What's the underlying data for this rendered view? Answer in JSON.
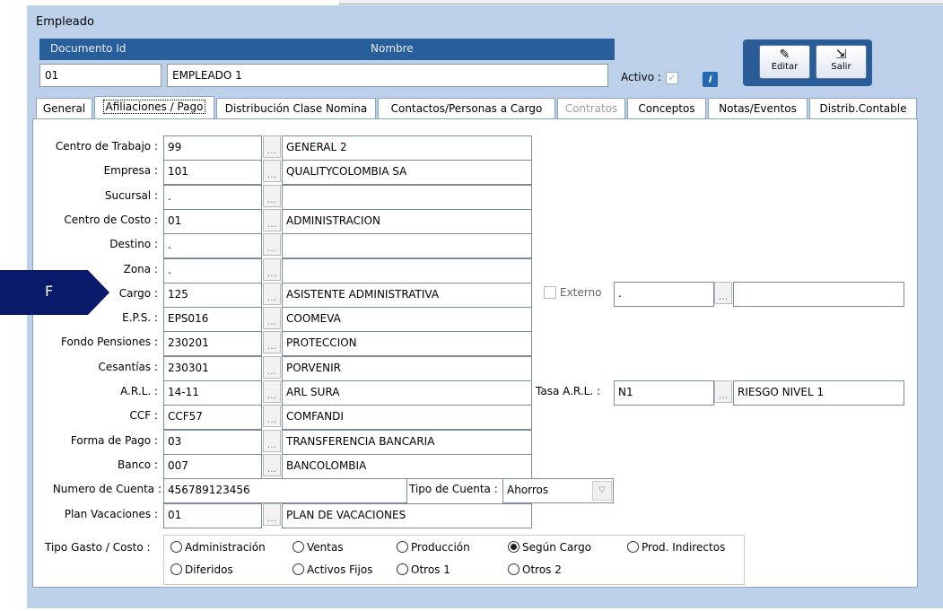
{
  "window": {
    "title": "Empleado"
  },
  "header": {
    "documento_label": "Documento Id",
    "nombre_label": "Nombre",
    "documento_value": "01",
    "nombre_value": "EMPLEADO 1",
    "activo_label": "Activo :",
    "activo_checked": true
  },
  "toolbar": {
    "editar_label": "Editar",
    "salir_label": "Salir"
  },
  "tabs": [
    {
      "label": "General"
    },
    {
      "label": "Afiliaciones / Pago",
      "active": true
    },
    {
      "label": "Distribución Clase Nomina"
    },
    {
      "label": "Contactos/Personas a Cargo"
    },
    {
      "label": "Contratos",
      "disabled": true
    },
    {
      "label": "Conceptos"
    },
    {
      "label": "Notas/Eventos"
    },
    {
      "label": "Distrib.Contable"
    }
  ],
  "marker": {
    "label": "F"
  },
  "rows": [
    {
      "label": "Centro de Trabajo :",
      "code": "99",
      "desc": "GENERAL 2"
    },
    {
      "label": "Empresa :",
      "code": "101",
      "desc": "QUALITYCOLOMBIA SA"
    },
    {
      "label": "Sucursal :",
      "code": ".",
      "desc": ""
    },
    {
      "label": "Centro de Costo :",
      "code": "01",
      "desc": "ADMINISTRACION"
    },
    {
      "label": "Destino :",
      "code": ".",
      "desc": ""
    },
    {
      "label": "Zona :",
      "code": ".",
      "desc": ""
    },
    {
      "label": "Cargo :",
      "code": "125",
      "desc": "ASISTENTE ADMINISTRATIVA"
    },
    {
      "label": "E.P.S. :",
      "code": "EPS016",
      "desc": "COOMEVA"
    },
    {
      "label": "Fondo Pensiones :",
      "code": "230201",
      "desc": "PROTECCION"
    },
    {
      "label": "Cesantías :",
      "code": "230301",
      "desc": "PORVENIR"
    },
    {
      "label": "A.R.L. :",
      "code": "14-11",
      "desc": "ARL SURA"
    },
    {
      "label": "CCF :",
      "code": "CCF57",
      "desc": "COMFANDI"
    },
    {
      "label": "Forma de Pago :",
      "code": "03",
      "desc": "TRANSFERENCIA BANCARIA"
    },
    {
      "label": "Banco :",
      "code": "007",
      "desc": "BANCOLOMBIA"
    }
  ],
  "cuenta": {
    "label": "Numero de Cuenta :",
    "value": "456789123456",
    "tipo_label": "Tipo de Cuenta :",
    "tipo_value": "Ahorros"
  },
  "vacaciones": {
    "label": "Plan Vacaciones :",
    "code": "01",
    "desc": "PLAN DE VACACIONES"
  },
  "externo": {
    "label": "Externo",
    "checked": false,
    "code": ".",
    "desc": ""
  },
  "tasa_arl": {
    "label": "Tasa A.R.L. :",
    "code": "N1",
    "desc": "RIESGO NIVEL 1"
  },
  "tipo_gasto": {
    "label": "Tipo Gasto / Costo :",
    "options": [
      {
        "label": "Administración",
        "selected": false
      },
      {
        "label": "Ventas",
        "selected": false
      },
      {
        "label": "Producción",
        "selected": false
      },
      {
        "label": "Según Cargo",
        "selected": true
      },
      {
        "label": "Prod. Indirectos",
        "selected": false
      },
      {
        "label": "Diferidos",
        "selected": false
      },
      {
        "label": "Activos Fijos",
        "selected": false
      },
      {
        "label": "Otros 1",
        "selected": false
      },
      {
        "label": "Otros 2",
        "selected": false
      }
    ]
  },
  "colors": {
    "header_blue": "#295e9c",
    "window_bg": "#bcd0ea",
    "marker": "#0a1a6b"
  },
  "icons": {
    "activo_check": "check-icon",
    "info": "info-icon",
    "editar": "edit-icon",
    "salir": "exit-door-icon",
    "lookup": "ellipsis-icon",
    "dropdown": "chevron-down-icon"
  }
}
